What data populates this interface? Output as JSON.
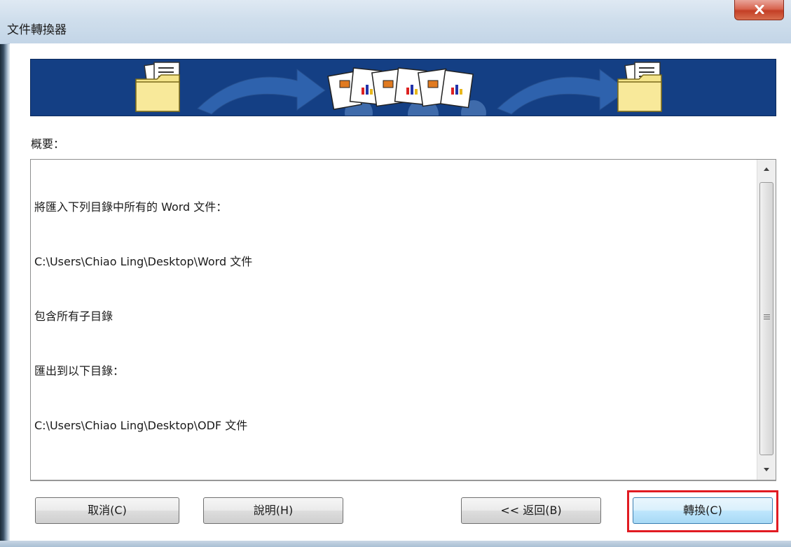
{
  "window": {
    "title": "文件轉換器",
    "close_icon": "close-icon"
  },
  "banner": {
    "icons": [
      "folder-icon",
      "arrow-icon",
      "documents-icon",
      "arrow-icon",
      "folder-icon"
    ]
  },
  "summary": {
    "label": "概要：",
    "lines": [
      "將匯入下列目錄中所有的 Word 文件：",
      "C:\\Users\\Chiao Ling\\Desktop\\Word 文件",
      "包含所有子目錄",
      "匯出到以下目錄：",
      "C:\\Users\\Chiao Ling\\Desktop\\ODF 文件"
    ]
  },
  "buttons": {
    "cancel": "取消(C)",
    "help": "說明(H)",
    "back": "<< 返回(B)",
    "convert": "轉換(C)"
  },
  "colors": {
    "banner_bg": "#143f84",
    "highlight": "#e11b22",
    "close_button": "#c33f26"
  }
}
